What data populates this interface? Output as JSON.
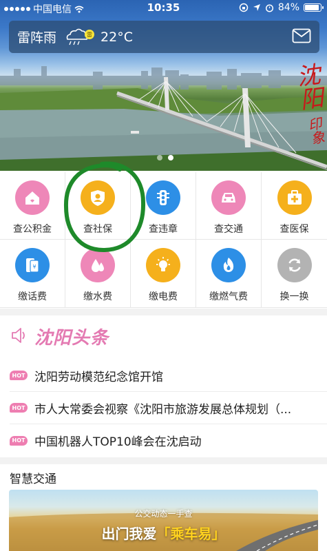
{
  "status_bar": {
    "carrier": "中国电信",
    "time": "10:35",
    "battery": "84%",
    "battery_level": 0.84
  },
  "weather": {
    "city": "雷阵雨",
    "temperature": "22°C",
    "icon": "thunderstorm-icon",
    "badge": "雷"
  },
  "banner": {
    "calligraphy": "沈阳",
    "calligraphy_small": "印象",
    "slides": 2,
    "active_slide": 2
  },
  "services": [
    {
      "label": "查公积金",
      "icon": "house-icon",
      "color": "#ee87b8"
    },
    {
      "label": "查社保",
      "icon": "shield-person-icon",
      "color": "#f5b01c"
    },
    {
      "label": "查违章",
      "icon": "traffic-light-icon",
      "color": "#2d8fe6"
    },
    {
      "label": "查交通",
      "icon": "car-icon",
      "color": "#ee87b8"
    },
    {
      "label": "查医保",
      "icon": "medical-kit-icon",
      "color": "#f5b01c"
    },
    {
      "label": "缴话费",
      "icon": "phone-icon",
      "color": "#2d8fe6"
    },
    {
      "label": "缴水费",
      "icon": "water-drop-icon",
      "color": "#ee87b8"
    },
    {
      "label": "缴电费",
      "icon": "light-bulb-icon",
      "color": "#f5b01c"
    },
    {
      "label": "缴燃气费",
      "icon": "flame-icon",
      "color": "#2d8fe6"
    },
    {
      "label": "换一换",
      "icon": "refresh-icon",
      "color": "#b3b3b3"
    }
  ],
  "news": {
    "title": "沈阳头条",
    "badge": "HOT",
    "items": [
      {
        "text": "沈阳劳动模范纪念馆开馆"
      },
      {
        "text": "市人大常委会视察《沈阳市旅游发展总体规划（..."
      },
      {
        "text": "中国机器人TOP10峰会在沈启动"
      }
    ]
  },
  "traffic": {
    "title": "智慧交通",
    "banner_subtitle": "公交动态一手查",
    "banner_main_prefix": "出门我爱",
    "banner_main_highlight": "乘车易"
  },
  "colors": {
    "pink": "#ee87b8",
    "yellow": "#f5b01c",
    "blue": "#2d8fe6",
    "gray": "#b3b3b3",
    "hot": "#ee7eb1",
    "annotation_green": "#1e8a2a"
  }
}
